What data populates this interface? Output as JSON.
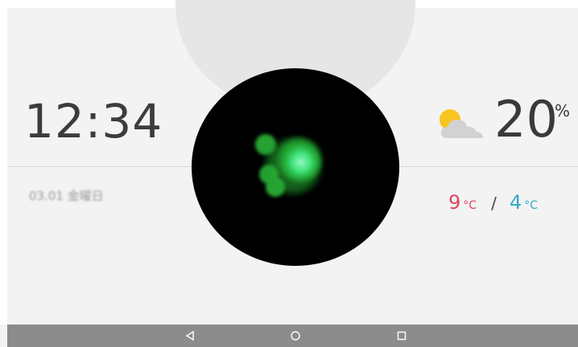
{
  "clock": {
    "time": "12:34"
  },
  "date": {
    "text": "03.01 金曜日"
  },
  "weather": {
    "icon": "partly-cloudy-icon",
    "temperature": "20",
    "unit": "%",
    "high": "9",
    "high_unit": "°C",
    "separator": "/",
    "low": "4",
    "low_unit": "°C",
    "colors": {
      "high": "#e0415f",
      "low": "#35a9c9",
      "sun": "#f7c51e",
      "cloud": "#d2d2d2"
    }
  },
  "voice": {
    "icon": "voice-assistant-orb-icon",
    "color": "#2fd24a"
  },
  "nav": {
    "back_icon": "back-triangle-icon",
    "home_icon": "home-circle-icon",
    "recents_icon": "recents-square-icon"
  }
}
